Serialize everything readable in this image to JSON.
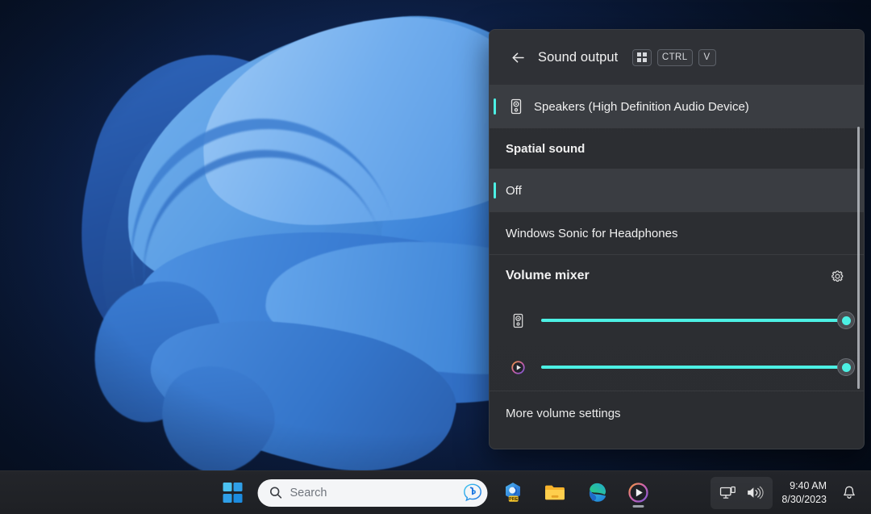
{
  "panel": {
    "header": {
      "back_icon": "back-arrow-icon",
      "title": "Sound output",
      "badges": [
        {
          "type": "icon",
          "name": "windows-key-icon",
          "label": ""
        },
        {
          "type": "text",
          "name": "ctrl-key-badge",
          "label": "CTRL"
        },
        {
          "type": "text",
          "name": "v-key-badge",
          "label": "V"
        }
      ]
    },
    "devices": [
      {
        "label": "Speakers (High Definition Audio Device)",
        "icon": "speaker-icon",
        "selected": true
      }
    ],
    "spatial_sound": {
      "title": "Spatial sound",
      "options": [
        {
          "label": "Off",
          "selected": true
        },
        {
          "label": "Windows Sonic for Headphones",
          "selected": false
        }
      ]
    },
    "volume_mixer": {
      "title": "Volume mixer",
      "settings_icon": "gear-icon",
      "channels": [
        {
          "name": "system-volume",
          "icon": "speaker-icon",
          "value": 100
        },
        {
          "name": "media-player-volume",
          "icon": "media-player-icon",
          "value": 100
        }
      ]
    },
    "footer": {
      "more_settings_label": "More volume settings"
    },
    "scrollbar": {
      "name": "panel-scrollbar"
    }
  },
  "taskbar": {
    "start_label": "Start",
    "search": {
      "placeholder": "Search",
      "search_icon": "search-icon",
      "bing_icon": "bing-chat-icon"
    },
    "apps": [
      {
        "name": "copilot-preview",
        "label": "Copilot",
        "badge": "PRE",
        "active": false
      },
      {
        "name": "file-explorer",
        "label": "File Explorer",
        "active": false
      },
      {
        "name": "microsoft-edge",
        "label": "Microsoft Edge",
        "active": false
      },
      {
        "name": "media-player",
        "label": "Media Player",
        "active": true
      }
    ],
    "tray": {
      "network_icon": "network-display-icon",
      "volume_icon": "volume-icon",
      "time": "9:40 AM",
      "date": "8/30/2023",
      "notification_icon": "bell-icon"
    }
  },
  "colors": {
    "accent": "#4cf0e4",
    "panel_bg": "#2b2d31",
    "selected_row": "#3a3d42",
    "taskbar_bg": "#1e2024"
  }
}
